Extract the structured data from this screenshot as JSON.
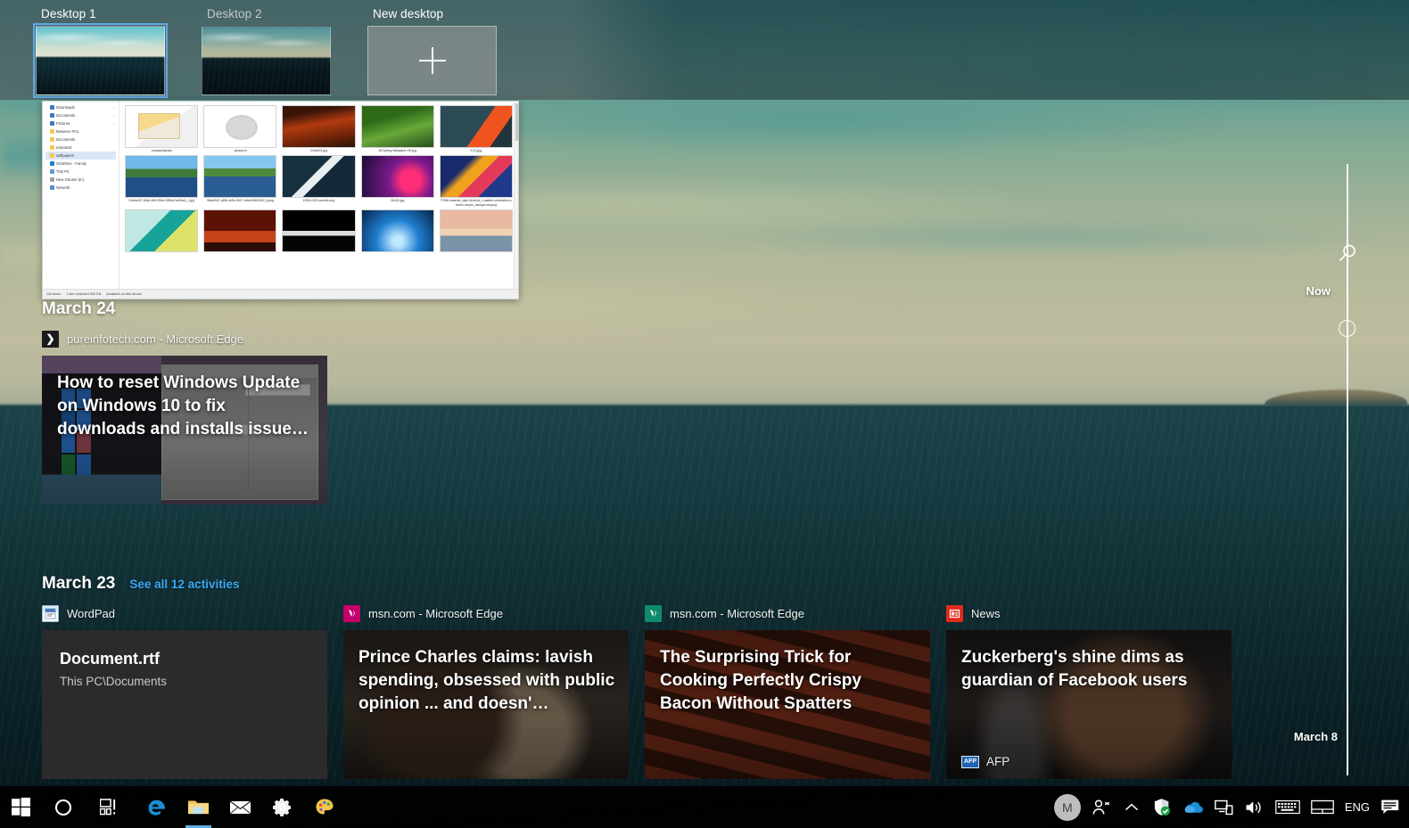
{
  "desktops": {
    "new_desktop_label": "New desktop",
    "items": [
      {
        "label": "Desktop 1",
        "selected": true
      },
      {
        "label": "Desktop 2",
        "selected": false
      }
    ]
  },
  "explorer_snapshot": {
    "nav_items": [
      {
        "label": "Downloads",
        "icon": "download-icon",
        "pinned": true,
        "selected": false
      },
      {
        "label": "Documents",
        "icon": "document-icon",
        "pinned": true,
        "selected": false
      },
      {
        "label": "Pictures",
        "icon": "pictures-icon",
        "pinned": true,
        "selected": false
      },
      {
        "label": "Between PCs",
        "icon": "folder-icon",
        "pinned": false,
        "selected": false
      },
      {
        "label": "Documents",
        "icon": "folder-icon",
        "pinned": false,
        "selected": false
      },
      {
        "label": "educated",
        "icon": "folder-icon",
        "pinned": false,
        "selected": false
      },
      {
        "label": "wallpapers",
        "icon": "folder-icon",
        "pinned": false,
        "selected": true
      },
      {
        "label": "OneDrive - Family",
        "icon": "onedrive-icon",
        "pinned": false,
        "selected": false
      },
      {
        "label": "This PC",
        "icon": "this-pc-icon",
        "pinned": false,
        "selected": false
      },
      {
        "label": "New Volume (E:)",
        "icon": "drive-icon",
        "pinned": false,
        "selected": false
      },
      {
        "label": "Network",
        "icon": "network-icon",
        "pinned": false,
        "selected": false
      }
    ],
    "files": [
      {
        "name": ".picasaoriginals",
        "art": "t-folder"
      },
      {
        "name": ".picasa.ini",
        "art": "t-gear"
      },
      {
        "name": "22dd401.jpg",
        "art": "t-autumn"
      },
      {
        "name": "48-Spring-Wallpaper-HD.jpg",
        "art": "t-forest"
      },
      {
        "name": "5 (1).jpg",
        "art": "t-geo1"
      },
      {
        "name": "51eea007-60db-4f84-95b0-0894a7a82ea3_1.jpg",
        "art": "t-lake1"
      },
      {
        "name": "98cd0647-a85e-4b9c-8027-bbbe3060f2d0_4.jpeg",
        "art": "t-lake2"
      },
      {
        "name": "1920x1920-wonder.png",
        "art": "t-metal"
      },
      {
        "name": "2614D.jpg",
        "art": "t-space"
      },
      {
        "name": "77988-material_style-Android_L-pattern-minimalism-colorful-simple_background.png",
        "art": "t-mat"
      },
      {
        "name": "",
        "art": "t-teal"
      },
      {
        "name": "",
        "art": "t-redtree"
      },
      {
        "name": "",
        "art": "t-piano"
      },
      {
        "name": "",
        "art": "t-blue"
      },
      {
        "name": "",
        "art": "t-sunset"
      }
    ],
    "status_items": [
      "116 items",
      "1 item selected  303 KB",
      "Available on this device"
    ]
  },
  "timeline": {
    "now_label": "Now",
    "oldest_label": "March 8",
    "search_icon": "search-icon",
    "groups": [
      {
        "title": "March 24",
        "see_all_label": "",
        "cards": [
          {
            "app_icon": "console-icon",
            "app_title": "pureinfotech.com - Microsoft Edge",
            "headline": "How to reset Windows Update on Windows 10 to fix downloads and installs issue…",
            "source": "",
            "bg": "bg-winupdate",
            "kind": "web"
          }
        ]
      },
      {
        "title": "March 23",
        "see_all_label": "See all 12 activities",
        "cards": [
          {
            "app_icon": "wordpad-icon",
            "app_title": "WordPad",
            "headline": "Document.rtf",
            "subtitle": "This PC\\Documents",
            "source": "",
            "bg": "bg-plain-dark",
            "kind": "file"
          },
          {
            "app_icon": "msn-icon-pink",
            "app_title": "msn.com - Microsoft Edge",
            "headline": "Prince Charles claims: lavish spending, obsessed with public opinion ... and doesn'…",
            "source": "",
            "bg": "bg-charles",
            "kind": "web"
          },
          {
            "app_icon": "msn-icon-green",
            "app_title": "msn.com - Microsoft Edge",
            "headline": "The Surprising Trick for Cooking Perfectly Crispy Bacon Without Spatters",
            "source": "",
            "bg": "bg-bacon",
            "kind": "web"
          },
          {
            "app_icon": "news-icon",
            "app_title": "News",
            "headline": "Zuckerberg's shine dims as guardian of Facebook users",
            "source": "AFP",
            "source_badge": "AFP",
            "bg": "bg-zuck",
            "kind": "web"
          }
        ]
      }
    ]
  },
  "taskbar": {
    "left_buttons": [
      {
        "name": "start-button",
        "icon": "windows-logo-icon",
        "active": false
      },
      {
        "name": "cortana-button",
        "icon": "cortana-circle-icon",
        "active": false
      },
      {
        "name": "task-view-button",
        "icon": "task-view-icon",
        "active": false
      },
      {
        "name": "edge-button",
        "icon": "edge-icon",
        "active": false
      },
      {
        "name": "file-explorer-button",
        "icon": "folder-icon",
        "active": true
      },
      {
        "name": "mail-button",
        "icon": "mail-icon",
        "active": false
      },
      {
        "name": "settings-button",
        "icon": "gear-icon",
        "active": false
      },
      {
        "name": "paint3d-button",
        "icon": "paint-palette-icon",
        "active": false
      }
    ],
    "tray": {
      "avatar_initial": "M",
      "people_icon": "people-icon",
      "overflow_icon": "chevron-up-icon",
      "defender_icon": "shield-check-icon",
      "onedrive_icon": "onedrive-cloud-icon",
      "network_icon": "network-icon",
      "volume_icon": "speaker-icon",
      "keyboard_icon": "touch-keyboard-icon",
      "touchpad_icon": "touchpad-icon",
      "language": "ENG",
      "action_center_icon": "action-center-icon"
    }
  },
  "colors": {
    "accent_link": "#3ba7f0",
    "selection_outline": "#5ea9e8",
    "taskbar_bg": "#000000",
    "card_bg": "#2b2b2b"
  }
}
